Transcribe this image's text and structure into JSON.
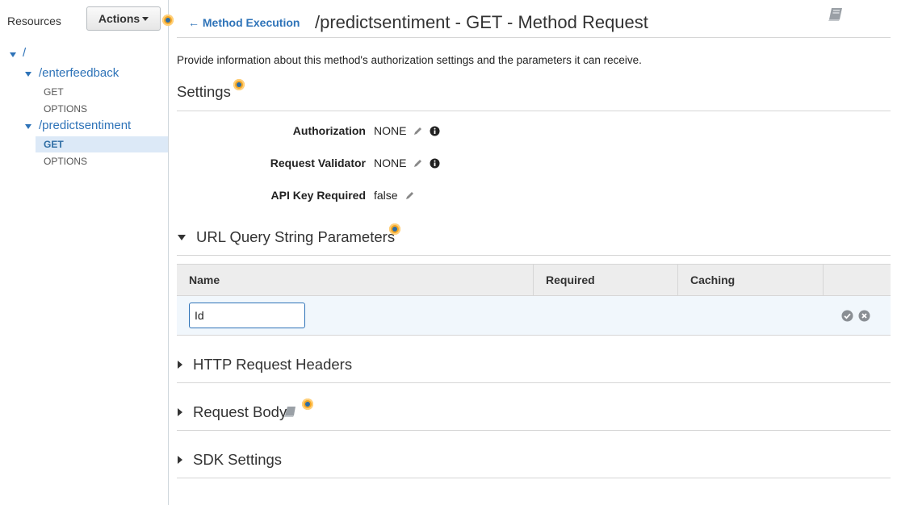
{
  "sidebar": {
    "resources_label": "Resources",
    "actions_label": "Actions",
    "tree": {
      "root": "/",
      "items": [
        {
          "path": "/enterfeedback",
          "methods": [
            "GET",
            "OPTIONS"
          ]
        },
        {
          "path": "/predictsentiment",
          "methods": [
            "GET",
            "OPTIONS"
          ]
        }
      ],
      "selected": "/predictsentiment GET"
    }
  },
  "header": {
    "back_link": "Method Execution",
    "title": "/predictsentiment - GET - Method Request",
    "doc_icon": "book-icon"
  },
  "description": "Provide information about this method's authorization settings and the parameters it can receive.",
  "settings": {
    "heading": "Settings",
    "rows": [
      {
        "label": "Authorization",
        "value": "NONE"
      },
      {
        "label": "Request Validator",
        "value": "NONE"
      },
      {
        "label": "API Key Required",
        "value": "false"
      }
    ]
  },
  "query_params": {
    "heading": "URL Query String Parameters",
    "expanded": true,
    "columns": [
      "Name",
      "Required",
      "Caching"
    ],
    "edit_row": {
      "name_value": "Id"
    }
  },
  "sections": {
    "headers": "HTTP Request Headers",
    "body": "Request Body",
    "sdk": "SDK Settings"
  },
  "colors": {
    "link": "#2e73b8",
    "hotspot": "#f5a623",
    "selected_bg": "#dce9f7",
    "row_bg": "#f1f7fc"
  }
}
